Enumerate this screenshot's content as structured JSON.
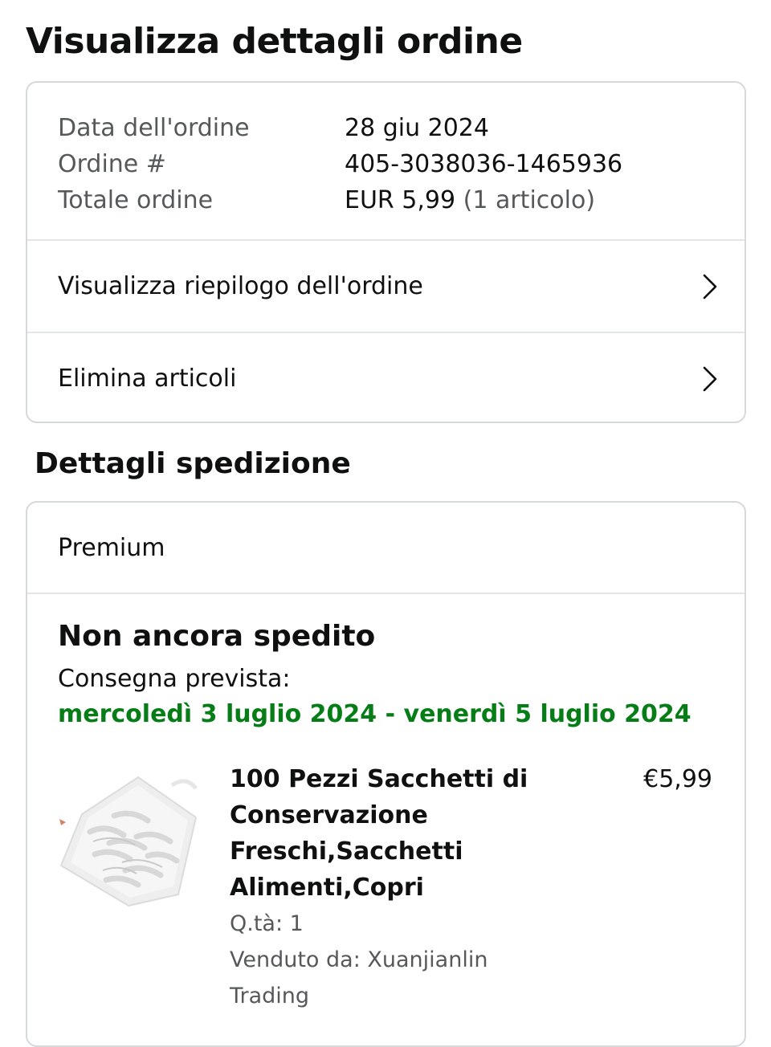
{
  "page": {
    "title": "Visualizza dettagli ordine"
  },
  "order": {
    "date_label": "Data dell'ordine",
    "date_value": "28 giu 2024",
    "number_label": "Ordine #",
    "number_value": "405-3038036-1465936",
    "total_label": "Totale ordine",
    "total_value": "EUR 5,99",
    "total_items": "(1 articolo)"
  },
  "links": {
    "summary": "Visualizza riepilogo dell'ordine",
    "remove": "Elimina articoli"
  },
  "shipping": {
    "section_title": "Dettagli spedizione",
    "type": "Premium",
    "status": "Non ancora spedito",
    "delivery_label": "Consegna prevista:",
    "delivery_date": "mercoledì 3 luglio 2024 - venerdì 5 luglio 2024",
    "delivery_color": "#067d17"
  },
  "item": {
    "title": "100 Pezzi Sacchetti di Conservazione Freschi,Sacchetti Alimenti,Copri",
    "price": "€5,99",
    "qty": "Q.tà: 1",
    "seller": "Venduto da: Xuanjianlin Trading",
    "image": "product-bag-image"
  },
  "icons": {
    "chevron": "chevron-right-icon"
  }
}
